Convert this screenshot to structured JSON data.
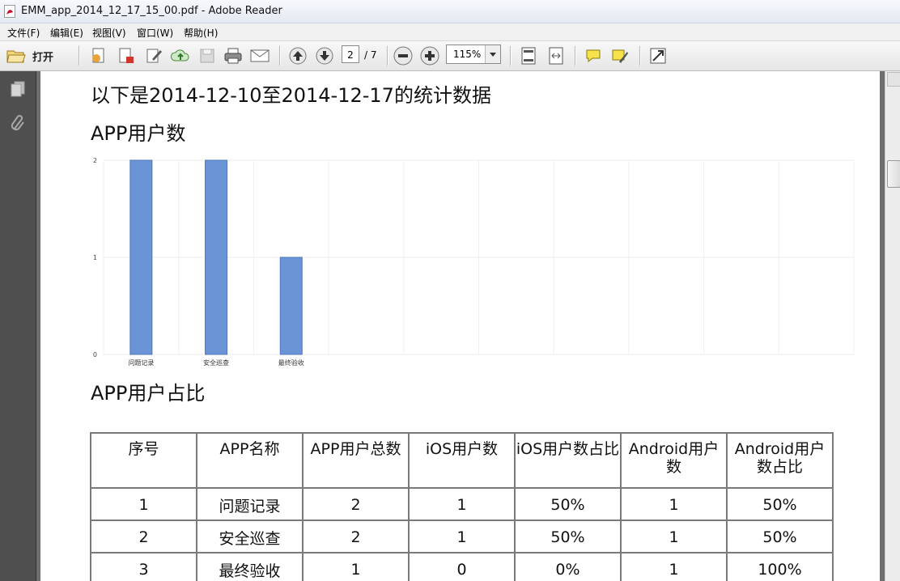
{
  "window": {
    "title": "EMM_app_2014_12_17_15_00.pdf - Adobe Reader"
  },
  "menu": [
    "文件(F)",
    "编辑(E)",
    "视图(V)",
    "窗口(W)",
    "帮助(H)"
  ],
  "toolbar": {
    "open_label": "打开",
    "page_current": "2",
    "page_total": "/ 7",
    "zoom": "115%"
  },
  "document": {
    "intro": "以下是2014-12-10至2014-12-17的统计数据",
    "users_heading": "APP用户数",
    "share_heading": "APP用户占比",
    "table": {
      "headers": [
        "序号",
        "APP名称",
        "APP用户总数",
        "iOS用户数",
        "iOS用户数占比",
        "Android用户数",
        "Android用户数占比"
      ],
      "rows": [
        [
          "1",
          "问题记录",
          "2",
          "1",
          "50%",
          "1",
          "50%"
        ],
        [
          "2",
          "安全巡查",
          "2",
          "1",
          "50%",
          "1",
          "50%"
        ],
        [
          "3",
          "最终验收",
          "1",
          "0",
          "0%",
          "1",
          "100%"
        ]
      ]
    }
  },
  "chart_data": {
    "type": "bar",
    "categories": [
      "问题记录",
      "安全巡查",
      "最终验收"
    ],
    "values": [
      2,
      2,
      1
    ],
    "yticks": [
      "0",
      "1",
      "2"
    ],
    "ylim": [
      0,
      2
    ],
    "bar_color": "#6a94d6",
    "grid": true
  }
}
